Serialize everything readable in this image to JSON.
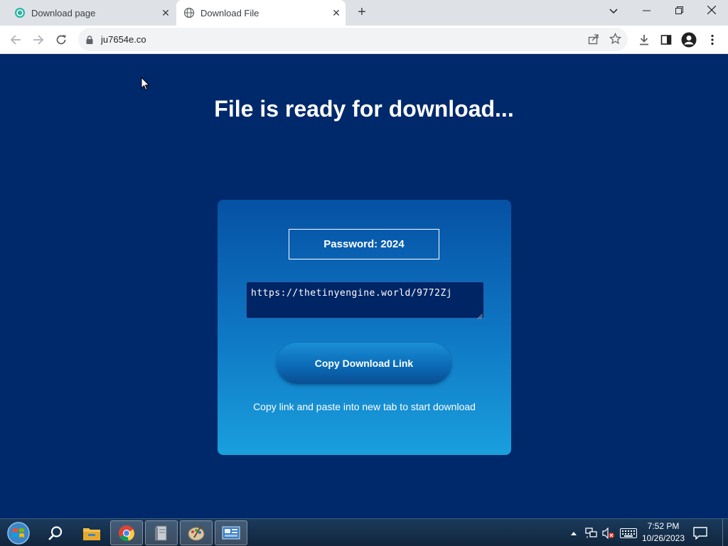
{
  "browser": {
    "tabs": [
      {
        "title": "Download page",
        "active": false
      },
      {
        "title": "Download File",
        "active": true
      }
    ],
    "url": "ju7654e.co"
  },
  "page": {
    "headline": "File is ready for download...",
    "password_label": "Password: 2024",
    "download_link": "https://thetinyengine.world/9772Zj",
    "copy_button": "Copy Download Link",
    "hint": "Copy link and paste into new tab to start download"
  },
  "taskbar": {
    "time": "7:52 PM",
    "date": "10/26/2023"
  },
  "colors": {
    "page_bg": "#00296b",
    "card_top": "#0651a4",
    "card_bottom": "#1a9fdd",
    "button": "#0a68b4"
  }
}
